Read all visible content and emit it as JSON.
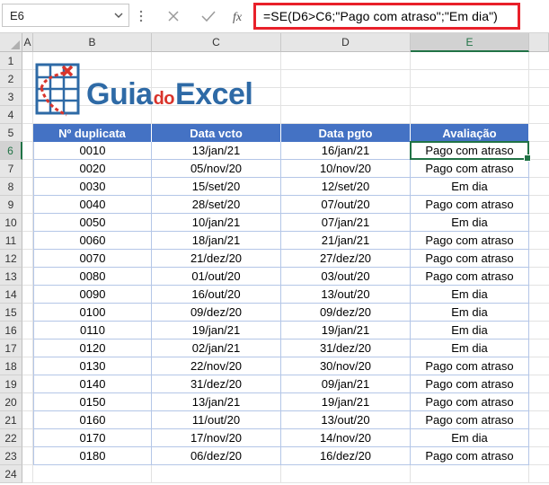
{
  "formula_bar": {
    "name_box": "E6",
    "formula": "=SE(D6>C6;\"Pago com atraso\";\"Em dia\")"
  },
  "columns": [
    "A",
    "B",
    "C",
    "D",
    "E"
  ],
  "rows": [
    "1",
    "2",
    "3",
    "4",
    "5",
    "6",
    "7",
    "8",
    "9",
    "10",
    "11",
    "12",
    "13",
    "14",
    "15",
    "16",
    "17",
    "18",
    "19",
    "20",
    "21",
    "22",
    "23",
    "24"
  ],
  "active_cell": "E6",
  "logo": {
    "part1": "Guia",
    "part2": "do",
    "part3": "Excel"
  },
  "table": {
    "headers": [
      "Nº duplicata",
      "Data vcto",
      "Data pgto",
      "Avaliação"
    ],
    "rows": [
      [
        "0010",
        "13/jan/21",
        "16/jan/21",
        "Pago com atraso"
      ],
      [
        "0020",
        "05/nov/20",
        "10/nov/20",
        "Pago com atraso"
      ],
      [
        "0030",
        "15/set/20",
        "12/set/20",
        "Em dia"
      ],
      [
        "0040",
        "28/set/20",
        "07/out/20",
        "Pago com atraso"
      ],
      [
        "0050",
        "10/jan/21",
        "07/jan/21",
        "Em dia"
      ],
      [
        "0060",
        "18/jan/21",
        "21/jan/21",
        "Pago com atraso"
      ],
      [
        "0070",
        "21/dez/20",
        "27/dez/20",
        "Pago com atraso"
      ],
      [
        "0080",
        "01/out/20",
        "03/out/20",
        "Pago com atraso"
      ],
      [
        "0090",
        "16/out/20",
        "13/out/20",
        "Em dia"
      ],
      [
        "0100",
        "09/dez/20",
        "09/dez/20",
        "Em dia"
      ],
      [
        "0110",
        "19/jan/21",
        "19/jan/21",
        "Em dia"
      ],
      [
        "0120",
        "02/jan/21",
        "31/dez/20",
        "Em dia"
      ],
      [
        "0130",
        "22/nov/20",
        "30/nov/20",
        "Pago com atraso"
      ],
      [
        "0140",
        "31/dez/20",
        "09/jan/21",
        "Pago com atraso"
      ],
      [
        "0150",
        "13/jan/21",
        "19/jan/21",
        "Pago com atraso"
      ],
      [
        "0160",
        "11/out/20",
        "13/out/20",
        "Pago com atraso"
      ],
      [
        "0170",
        "17/nov/20",
        "14/nov/20",
        "Em dia"
      ],
      [
        "0180",
        "06/dez/20",
        "16/dez/20",
        "Pago com atraso"
      ]
    ]
  },
  "colors": {
    "header_fill": "#4472c4",
    "selection_green": "#217346",
    "highlight_red": "#e8202a",
    "logo_blue": "#2e6aa6"
  }
}
